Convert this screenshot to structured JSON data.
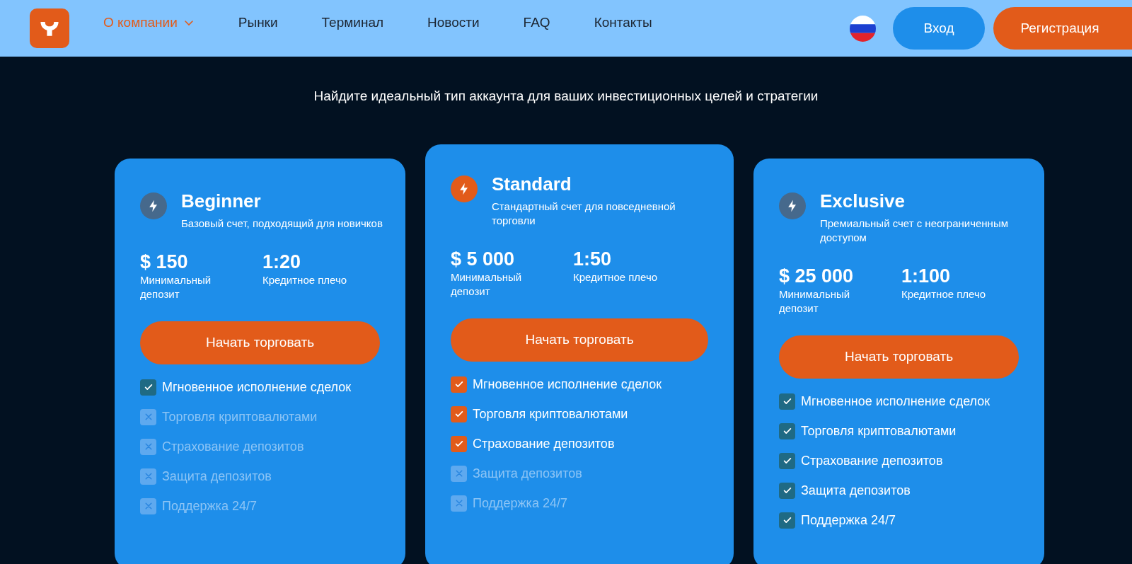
{
  "nav": {
    "items": [
      {
        "label": "О компании",
        "selected": true,
        "dropdown": true
      },
      {
        "label": "Рынки",
        "selected": false,
        "dropdown": false
      },
      {
        "label": "Терминал",
        "selected": false,
        "dropdown": false
      },
      {
        "label": "Новости",
        "selected": false,
        "dropdown": false
      },
      {
        "label": "FAQ",
        "selected": false,
        "dropdown": false
      },
      {
        "label": "Контакты",
        "selected": false,
        "dropdown": false
      }
    ],
    "login": "Вход",
    "register": "Регистрация"
  },
  "subtitle": "Найдите идеальный тип аккаунта для ваших инвестиционных целей и стратегии",
  "plans": [
    {
      "name": "Beginner",
      "featured": false,
      "description": "Базовый счет, подходящий для новичков",
      "deposit": "$ 150",
      "deposit_label": "Минимальный депозит",
      "leverage": "1:20",
      "leverage_label": "Кредитное плечо",
      "button": "Начать торговать",
      "features": [
        {
          "label": "Мгновенное исполнение сделок",
          "included": true
        },
        {
          "label": "Торговля криптовалютами",
          "included": false
        },
        {
          "label": "Страхование депозитов",
          "included": false
        },
        {
          "label": "Защита депозитов",
          "included": false
        },
        {
          "label": "Поддержка 24/7",
          "included": false
        }
      ]
    },
    {
      "name": "Standard",
      "featured": true,
      "description": "Стандартный счет для повседневной торговли",
      "deposit": "$ 5 000",
      "deposit_label": "Минимальный депозит",
      "leverage": "1:50",
      "leverage_label": "Кредитное плечо",
      "button": "Начать торговать",
      "features": [
        {
          "label": "Мгновенное исполнение сделок",
          "included": true
        },
        {
          "label": "Торговля криптовалютами",
          "included": true
        },
        {
          "label": "Страхование депозитов",
          "included": true
        },
        {
          "label": "Защита депозитов",
          "included": false
        },
        {
          "label": "Поддержка 24/7",
          "included": false
        }
      ]
    },
    {
      "name": "Exclusive",
      "featured": false,
      "description": "Премиальный счет с неограниченным доступом",
      "deposit": "$ 25 000",
      "deposit_label": "Минимальный депозит",
      "leverage": "1:100",
      "leverage_label": "Кредитное плечо",
      "button": "Начать торговать",
      "features": [
        {
          "label": "Мгновенное исполнение сделок",
          "included": true
        },
        {
          "label": "Торговля криптовалютами",
          "included": true
        },
        {
          "label": "Страхование депозитов",
          "included": true
        },
        {
          "label": "Защита депозитов",
          "included": true
        },
        {
          "label": "Поддержка 24/7",
          "included": true
        }
      ]
    }
  ]
}
